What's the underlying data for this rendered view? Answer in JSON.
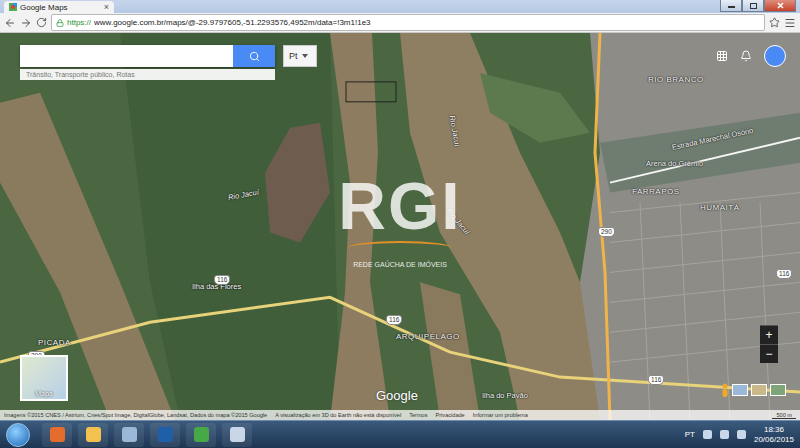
{
  "browser": {
    "tab_title": "Google Maps",
    "tab_close": "×",
    "url_scheme": "https://",
    "url_rest": "www.google.com.br/maps/@-29.9797605,-51.2293576,4952m/data=!3m1!1e3"
  },
  "map": {
    "search_hint": "Trânsito, Transporte público, Rotas",
    "language": "Pt",
    "labels": [
      {
        "text": "Rio Jacuí",
        "kind": "river"
      },
      {
        "text": "Rio Jacuí",
        "kind": "river"
      },
      {
        "text": "Rio Jacuí",
        "kind": "river"
      },
      {
        "text": "RIO BRANCO",
        "kind": "district"
      },
      {
        "text": "Estrada Marechal Osório",
        "kind": "place"
      },
      {
        "text": "Arena do Grêmio",
        "kind": "place"
      },
      {
        "text": "FARRAPOS",
        "kind": "district"
      },
      {
        "text": "HUMAITÁ",
        "kind": "district"
      },
      {
        "text": "Ilha das Flores",
        "kind": "place"
      },
      {
        "text": "ARQUIPÉLAGO",
        "kind": "district"
      },
      {
        "text": "Ilha do Pavão",
        "kind": "place"
      },
      {
        "text": "PICADA",
        "kind": "district"
      }
    ],
    "road_shields": [
      "290",
      "116",
      "116",
      "290",
      "116",
      "116"
    ],
    "logo": "Google",
    "layer_tile": "Mapa",
    "zoom": [
      "+",
      "−"
    ],
    "attribution": [
      "Imagens ©2015 CNES / Astrium, Cnes/Spot Image, DigitalGlobe, Landsat, Dados do mapa ©2015 Google",
      "A visualização em 3D do Earth não está disponível",
      "Termos",
      "Privacidade",
      "Informar um problema"
    ],
    "scale": "500 m"
  },
  "watermark": {
    "logo": "RGI",
    "tagline": "REDE GAÚCHA DE IMÓVEIS"
  },
  "taskbar": {
    "language": "PT",
    "time": "18:36",
    "date": "20/06/2015"
  }
}
